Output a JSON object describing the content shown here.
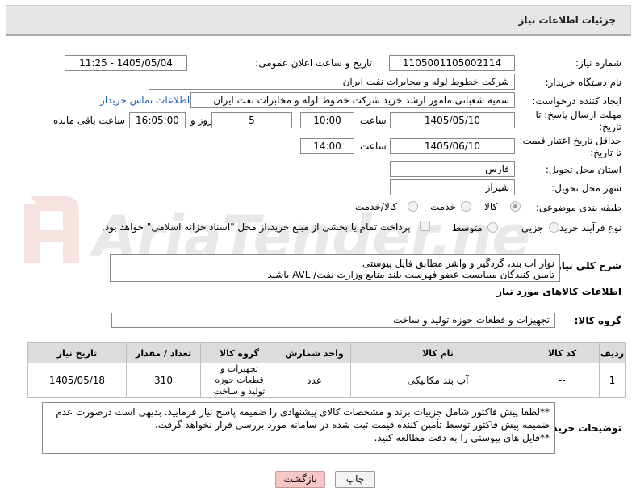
{
  "header": {
    "title": "جزئیات اطلاعات نیاز"
  },
  "need_number": {
    "label": "شماره نیاز:",
    "value": "1105001105002114"
  },
  "announce": {
    "label": "تاریخ و ساعت اعلان عمومی:",
    "value": "1405/05/04 - 11:25"
  },
  "buyer_org": {
    "label": "نام دستگاه خریدار:",
    "value": "شرکت خطوط لوله و مخابرات نفت ایران"
  },
  "requester": {
    "label": "ایجاد کننده درخواست:",
    "value": "سمیه شعبانی مامور ارشد خرید  شرکت خطوط لوله و مخابرات نفت ایران",
    "contact_link": "اطلاعات تماس خریدار"
  },
  "deadline": {
    "label": "مهلت ارسال پاسخ: تا تاریخ:",
    "date": "1405/05/10",
    "time_label": "ساعت",
    "time": "10:00",
    "days": "5",
    "days_label": "روز و",
    "remaining": "16:05:00",
    "remaining_label": "ساعت باقی مانده"
  },
  "price_validity": {
    "label": "حداقل تاریخ اعتبار قیمت: تا تاریخ:",
    "date": "1405/06/10",
    "time_label": "ساعت",
    "time": "14:00"
  },
  "province": {
    "label": "استان محل تحویل:",
    "value": "فارس"
  },
  "city": {
    "label": "شهر محل تحویل:",
    "value": "شیراز"
  },
  "category": {
    "label": "طبقه بندی موضوعی:",
    "options": [
      "کالا",
      "خدمت",
      "کالا/خدمت"
    ],
    "selected": "کالا"
  },
  "process": {
    "label": "نوع فرآیند خرید :",
    "options": [
      "جزیی",
      "متوسط"
    ],
    "selected": "",
    "payment_note": "پرداخت تمام یا بخشی از مبلغ خرید،از محل \"اسناد خزانه اسلامی\" خواهد بود."
  },
  "general_desc": {
    "label": "شرح کلی نیاز:",
    "line1": "نوار آب بند، گردگیر و واشر مطابق فایل پیوستی",
    "line2": "تامین کنندگان میبایست عضو فهرست بلند منابع وزارت نفت/  AVL  باشند"
  },
  "goods_info": {
    "title": "اطلاعات کالاهای مورد نیاز"
  },
  "goods_group": {
    "label": "گروه کالا:",
    "value": "تجهیزات و قطعات حوزه تولید و ساخت"
  },
  "table": {
    "headers": [
      "ردیف",
      "کد کالا",
      "نام کالا",
      "واحد شمارش",
      "گروه کالا",
      "تعداد / مقدار",
      "تاریخ نیاز"
    ],
    "rows": [
      {
        "row": "1",
        "code": "--",
        "name": "آب بند مکانیکی",
        "unit": "عدد",
        "group": "تجهیزات و قطعات حوزه تولید و ساخت",
        "qty": "310",
        "date": "1405/05/18"
      }
    ]
  },
  "buyer_notes": {
    "label": "توضیحات خریدار:",
    "line1": "**لطفا پیش فاکتور شامل جزییات برند و مشخصات کالای پیشنهادی را ضمیمه پاسخ نیاز فرمایید. بدیهی است درصورت عدم",
    "line2": "ضمیمه پیش فاکتور توسط تأمین کننده قیمت ثبت شده در سامانه مورد بررسی قرار نخواهد گرفت.",
    "line3": "**فایل های پیوستی را به دقت مطالعه کنید."
  },
  "buttons": {
    "print": "چاپ",
    "back": "بازگشت"
  },
  "watermark": {
    "text": "AriaTender.neT"
  },
  "colors": {
    "header_bg": "#e6e6e6",
    "link": "#1a62c2",
    "back_button": "#f5c7c7",
    "table_header": "#dcdcdc"
  }
}
